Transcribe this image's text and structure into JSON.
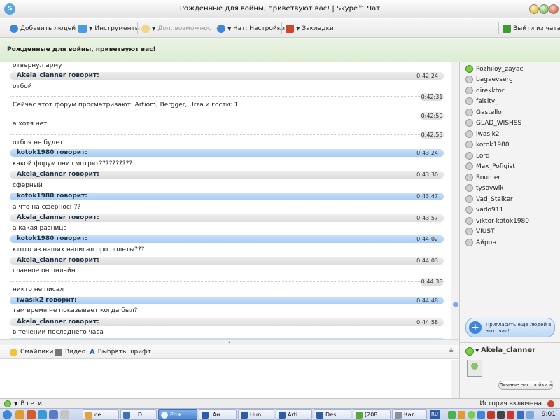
{
  "window": {
    "title": "Рожденные для войны, приветвуют вас! | Skype™ Чат"
  },
  "toolbar": {
    "add_people": "Добавить людей",
    "tools": "Инструменты",
    "extras": "Доп. возможности",
    "chat_settings": "Чат: Настройки",
    "bookmarks": "Закладки",
    "leave_chat": "Выйти из чата"
  },
  "topic": "Рожденные для войны, приветвуют вас!",
  "messages": [
    {
      "text": "отвернул арму"
    },
    {
      "sender": "Akela_clanner говорит:",
      "time": "0:42:24",
      "text": "отбой",
      "color": "gray"
    },
    {
      "time": "0:42:31",
      "text": "Сейчас этот форум просматривают: Artiom, Bergger, Urza и гости: 1"
    },
    {
      "time": "0:42:50",
      "text": "а хотя нет"
    },
    {
      "time": "0:42:53",
      "text": "отбоя не будет"
    },
    {
      "sender": "kotok1980 говорит:",
      "time": "0:43:24",
      "text": "какой форум они смотрят??????????",
      "color": "blue"
    },
    {
      "sender": "Akela_clanner говорит:",
      "time": "0:43:30",
      "text": "сферный",
      "color": "gray"
    },
    {
      "sender": "kotok1980 говорит:",
      "time": "0:43:47",
      "text": "а что на сферносн??",
      "color": "blue"
    },
    {
      "sender": "Akela_clanner говорит:",
      "time": "0:43:57",
      "text": "а какая разница",
      "color": "gray"
    },
    {
      "sender": "kotok1980 говорит:",
      "time": "0:44:02",
      "text": "ктото из наших написал про полеты???",
      "color": "blue"
    },
    {
      "sender": "Akela_clanner говорит:",
      "time": "0:44:03",
      "text": "главное он онлайн",
      "color": "gray"
    },
    {
      "time": "0:44:38",
      "text": "никто не писал"
    },
    {
      "sender": "iwasik2 говорит:",
      "time": "0:44:48",
      "text": "там время не показывает когда был?",
      "color": "blue"
    },
    {
      "sender": "Akela_clanner говорит:",
      "time": "0:44:58",
      "text": "в течении последнего часа",
      "color": "gray"
    }
  ],
  "participants": [
    {
      "name": "Pozhiloy_zayac",
      "online": true
    },
    {
      "name": "bagaevserg",
      "online": false
    },
    {
      "name": "direkktor",
      "online": false
    },
    {
      "name": "falsity_",
      "online": false
    },
    {
      "name": "Gastello",
      "online": false
    },
    {
      "name": "GLAD_WISHSS",
      "online": false
    },
    {
      "name": "iwasik2",
      "online": false
    },
    {
      "name": "kotok1980",
      "online": false
    },
    {
      "name": "Lord",
      "online": false
    },
    {
      "name": "Max_Pofigist",
      "online": false
    },
    {
      "name": "Roumer",
      "online": false
    },
    {
      "name": "tysovwik",
      "online": false
    },
    {
      "name": "Vad_Stalker",
      "online": false
    },
    {
      "name": "vado911",
      "online": false
    },
    {
      "name": "viktor-kotok1980",
      "online": false
    },
    {
      "name": "VIUST",
      "online": false
    },
    {
      "name": "Айрон",
      "online": false
    }
  ],
  "invite": "Пригласить еще людей в этот чат!",
  "profile": {
    "name": "Akela_clanner",
    "settings": "Личные настройки »"
  },
  "input_tools": {
    "smileys": "Смайлики",
    "video": "Видео",
    "font": "Выбрать шрифт"
  },
  "statusbar": {
    "status": "В сети",
    "history": "История включена"
  },
  "taskbar": {
    "buttons": [
      "се ...",
      ":: D...",
      "Рож...",
      ":Ан...",
      "Hun...",
      "Arti...",
      "Des...",
      "[208...",
      "Кал..."
    ],
    "lang": "RU",
    "clock": "9:01"
  },
  "colors": {
    "blue_header": "#b7d5f6",
    "gray_header": "#e3e3e3",
    "topic_bg": "#e2f0da",
    "online_green": "#7ccc4c"
  }
}
